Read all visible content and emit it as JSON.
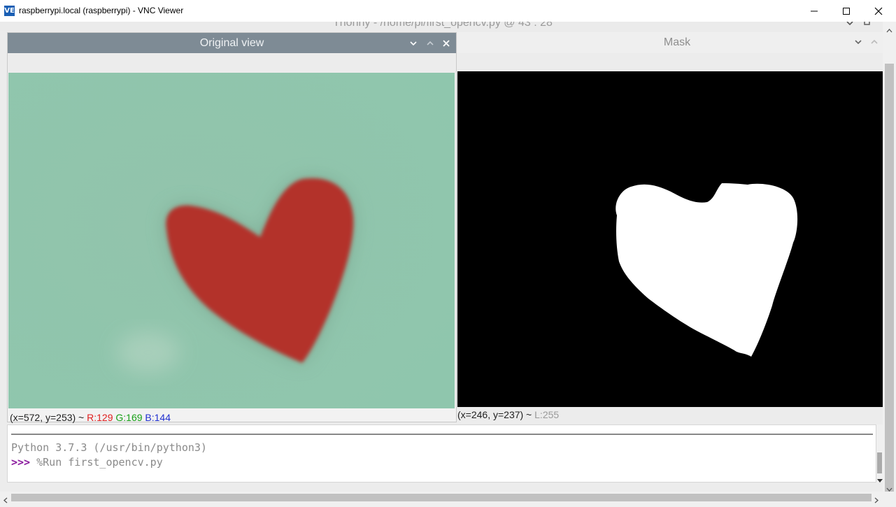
{
  "window": {
    "title": "raspberrypi.local (raspberrypi) - VNC Viewer",
    "logo_text": "VE"
  },
  "thonny": {
    "title": "Thonny  -  /home/pi/first_opencv.py  @  43 : 28"
  },
  "original_view": {
    "title": "Original view",
    "status": {
      "coords": "(x=572, y=253) ~ ",
      "r": "R:129",
      "g": "G:169",
      "b": "B:144"
    },
    "colors": {
      "r": "#e02020",
      "g": "#18a018",
      "b": "#2030d0",
      "background": "#93c8ad",
      "heart": "#b3302c"
    }
  },
  "mask": {
    "title": "Mask",
    "status": {
      "coords": "(x=246, y=237) ~ ",
      "l": "L:255"
    }
  },
  "shell": {
    "banner": "Python 3.7.3 (/usr/bin/python3)",
    "prompt": ">>>",
    "command": "%Run first_opencv.py",
    "colors": {
      "prompt": "#8b1a9e",
      "text": "#8a8a8a"
    }
  }
}
